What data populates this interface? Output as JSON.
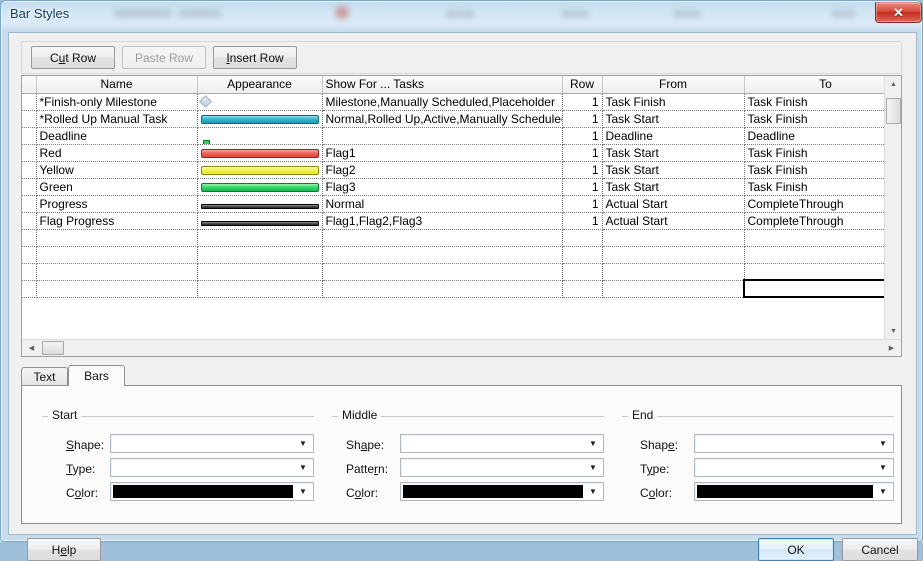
{
  "window": {
    "title": "Bar Styles",
    "close_label": "✕"
  },
  "toolbar": {
    "cut_row": "Cut Row",
    "paste_row": "Paste Row",
    "insert_row": "Insert Row"
  },
  "grid": {
    "headers": [
      "Name",
      "Appearance",
      "Show For ... Tasks",
      "Row",
      "From",
      "To"
    ],
    "rows": [
      {
        "name": "*Finish-only Milestone",
        "appearance": "milestone-diamond",
        "show_for": "Milestone,Manually Scheduled,Placeholder",
        "row": "1",
        "from": "Task Finish",
        "to": "Task Finish"
      },
      {
        "name": "*Rolled Up Manual Task",
        "appearance": "bar-teal",
        "show_for": "Normal,Rolled Up,Active,Manually Scheduled",
        "row": "1",
        "from": "Task Start",
        "to": "Task Finish"
      },
      {
        "name": "Deadline",
        "appearance": "deadline-arrow",
        "show_for": "",
        "row": "1",
        "from": "Deadline",
        "to": "Deadline"
      },
      {
        "name": "Red",
        "appearance": "bar-red",
        "show_for": "Flag1",
        "row": "1",
        "from": "Task Start",
        "to": "Task Finish"
      },
      {
        "name": "Yellow",
        "appearance": "bar-yellow",
        "show_for": "Flag2",
        "row": "1",
        "from": "Task Start",
        "to": "Task Finish"
      },
      {
        "name": "Green",
        "appearance": "bar-green",
        "show_for": "Flag3",
        "row": "1",
        "from": "Task Start",
        "to": "Task Finish"
      },
      {
        "name": "Progress",
        "appearance": "bar-progress",
        "show_for": "Normal",
        "row": "1",
        "from": "Actual Start",
        "to": "CompleteThrough"
      },
      {
        "name": "Flag Progress",
        "appearance": "bar-progress",
        "show_for": "Flag1,Flag2,Flag3",
        "row": "1",
        "from": "Actual Start",
        "to": "CompleteThrough"
      }
    ],
    "empty_rows": 4,
    "selected_cell_value": ""
  },
  "tabs": [
    {
      "label": "Text",
      "active": false
    },
    {
      "label": "Bars",
      "active": true
    }
  ],
  "bars_panel": {
    "start": {
      "title": "Start",
      "shape_label": "Shape:",
      "shape_value": "",
      "type_label": "Type:",
      "type_value": "",
      "color_label": "Color:",
      "color_value": "#000000"
    },
    "middle": {
      "title": "Middle",
      "shape_label": "Shape:",
      "shape_value": "",
      "pattern_label": "Pattern:",
      "pattern_value": "",
      "color_label": "Color:",
      "color_value": "#000000"
    },
    "end": {
      "title": "End",
      "shape_label": "Shape:",
      "shape_value": "",
      "type_label": "Type:",
      "type_value": "",
      "color_label": "Color:",
      "color_value": "#000000"
    }
  },
  "footer": {
    "help": "Help",
    "ok": "OK",
    "cancel": "Cancel"
  },
  "icons": {
    "scroll_up": "▲",
    "scroll_down": "▼",
    "scroll_left": "◀",
    "scroll_right": "▶",
    "dropdown": "▼"
  }
}
